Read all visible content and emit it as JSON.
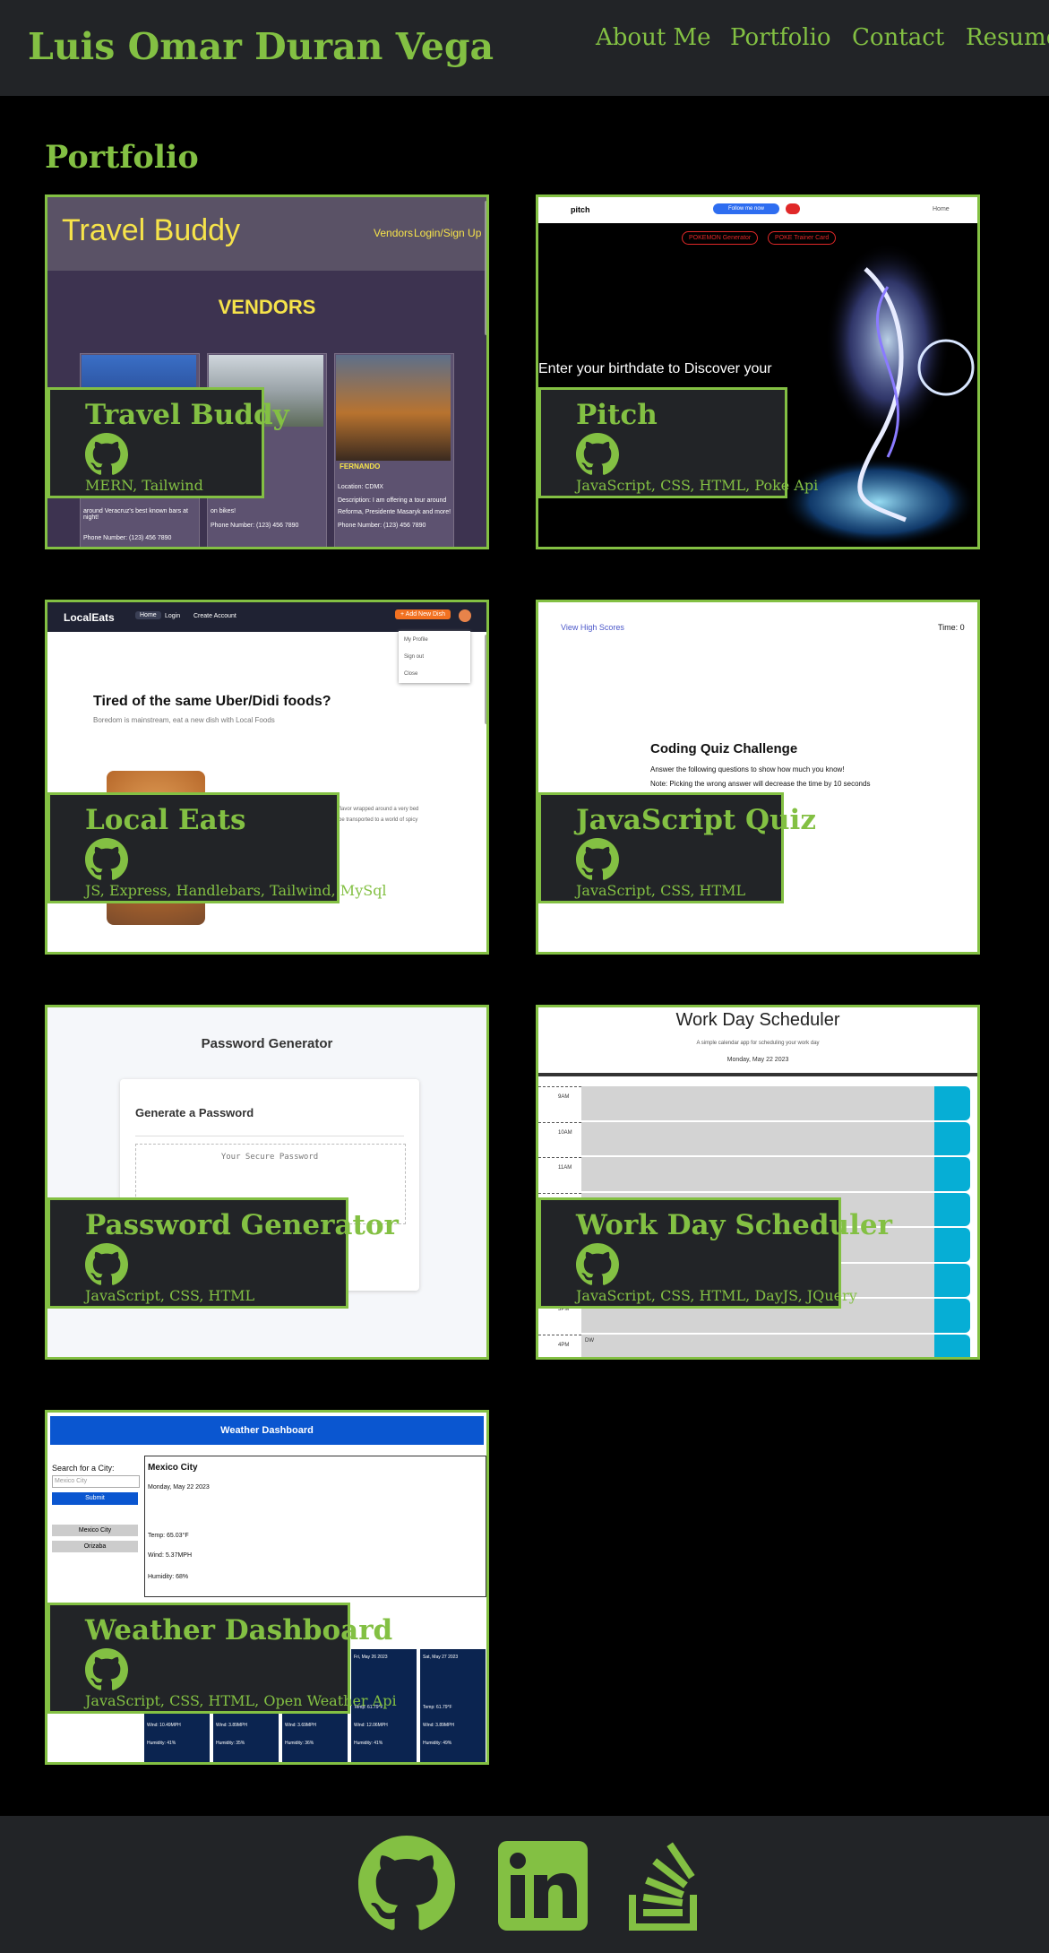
{
  "header": {
    "title": "Luis Omar Duran Vega",
    "nav": [
      "About Me",
      "Portfolio",
      "Contact",
      "Resume"
    ]
  },
  "section_title": "Portfolio",
  "projects": [
    {
      "title": "Travel Buddy",
      "tech": "MERN, Tailwind",
      "shot": {
        "app_title": "Travel Buddy",
        "nav_vendors": "Vendors",
        "nav_login": "Login/Sign Up",
        "heading": "VENDORS",
        "vendor_name": "FERNANDO",
        "col1_line1": "around Veracruz's best known bars at night!",
        "col1_line2": "Phone Number: (123) 456 7890",
        "col2_line1": "on bikes!",
        "col2_line2": "Phone Number: (123) 456 7890",
        "col3_line1": "Location: CDMX",
        "col3_line2": "Description: I am offering a tour around",
        "col3_line3": "Reforma, Presidente Masaryk and more!",
        "col3_line4": "Phone Number: (123) 456 7890"
      }
    },
    {
      "title": "Pitch",
      "tech": "JavaScript, CSS, HTML, Poke Api",
      "shot": {
        "logo": "pitch",
        "follow_btn": "Follow me now",
        "home_link": "Home",
        "btn1": "POKEMON Generator",
        "btn2": "POKE Trainer Card",
        "prompt": "Enter your birthdate to Discover your"
      }
    },
    {
      "title": "Local Eats",
      "tech": "JS, Express, Handlebars, Tailwind, MySql",
      "shot": {
        "logo": "LocalEats",
        "nav": [
          "Home",
          "Login",
          "Create Account"
        ],
        "add_btn": "+ Add New Dish",
        "menu": [
          "My Profile",
          "Sign out",
          "Close"
        ],
        "headline": "Tired of the same Uber/Didi foods?",
        "sub": "Boredom is mainstream, eat a new dish with Local Foods",
        "snippet1": "flavor wrapped around a very bed",
        "snippet2": "be transported to a world of spicy"
      }
    },
    {
      "title": "JavaScript Quiz",
      "tech": "JavaScript, CSS, HTML",
      "shot": {
        "scores": "View High Scores",
        "timer": "Time: 0",
        "heading": "Coding Quiz Challenge",
        "line1": "Answer the following questions to show how much you know!",
        "line2": "Note: Picking the wrong answer will decrease the time by 10 seconds"
      }
    },
    {
      "title": "Password Generator",
      "tech": "JavaScript, CSS, HTML",
      "shot": {
        "heading": "Password Generator",
        "card_title": "Generate a Password",
        "placeholder": "Your Secure Password"
      }
    },
    {
      "title": "Work Day Scheduler",
      "tech": "JavaScript, CSS, HTML, DayJS, JQuery",
      "shot": {
        "heading": "Work Day Scheduler",
        "sub": "A simple calendar app for scheduling your work day",
        "date": "Monday, May 22 2023",
        "hours": [
          "9AM",
          "10AM",
          "11AM",
          "12PM",
          "1PM",
          "2PM",
          "3PM",
          "4PM"
        ],
        "last_entry": "DW"
      }
    },
    {
      "title": "Weather Dashboard",
      "tech": "JavaScript, CSS, HTML, Open Weather Api",
      "shot": {
        "banner": "Weather Dashboard",
        "search_label": "Search for a City:",
        "search_placeholder": "Mexico City",
        "submit": "Submit",
        "history": [
          "Mexico City",
          "Orizaba"
        ],
        "city": "Mexico City",
        "date": "Monday, May 22 2023",
        "temp": "Temp: 65.03°F",
        "wind": "Wind: 5.37MPH",
        "humidity": "Humidity: 68%",
        "forecast_dates": [
          "Fri, May 26 2023",
          "Sat, May 27 2023"
        ],
        "forecast_temp": [
          "Temp: 61.79°F",
          "Temp: 61.79°F"
        ],
        "forecast_wind": [
          "Wind: 12.06MPH",
          "Wind: 3.89MPH"
        ],
        "forecast_hum": [
          "Humidity: 41%",
          "Humidity: 49%"
        ],
        "bottom_wind": [
          "Wind: 10.49MPH",
          "Wind: 3.89MPH",
          "Wind: 3.69MPH",
          "Wind: 12.06MPH",
          "Wind: 3.89MPH"
        ],
        "bottom_hum": [
          "Humidity: 41%",
          "Humidity: 35%",
          "Humidity: 36%",
          "Humidity: 41%",
          "Humidity: 49%"
        ]
      }
    }
  ],
  "footer": {
    "links": [
      "github-icon",
      "linkedin-icon",
      "stackoverflow-icon"
    ]
  },
  "colors": {
    "accent": "#83c043",
    "header_bg": "#222427",
    "page_bg": "#000000"
  }
}
